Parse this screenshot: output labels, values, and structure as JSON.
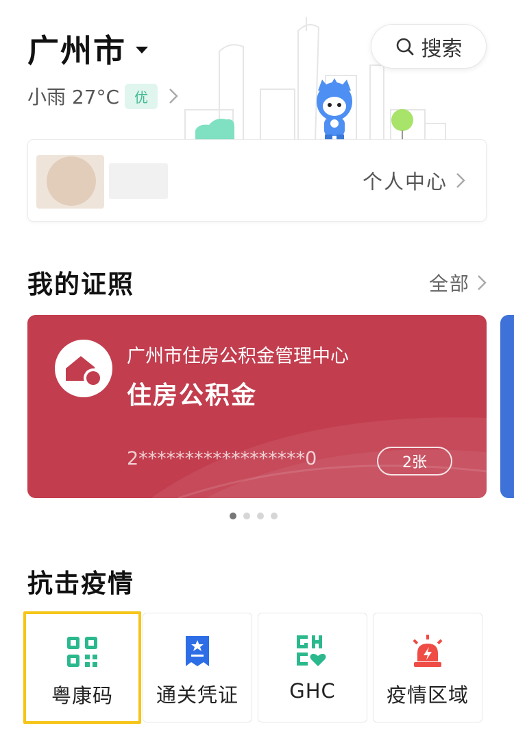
{
  "header": {
    "city": "广州市",
    "weather": "小雨 27°C",
    "air_quality": "优",
    "search_label": "搜索"
  },
  "personal": {
    "link_label": "个人中心"
  },
  "certificates": {
    "section_title": "我的证照",
    "see_all_label": "全部",
    "card": {
      "issuer": "广州市住房公积金管理中心",
      "title": "住房公积金",
      "number": "2******************0",
      "count": "2张"
    },
    "page_indicator": {
      "pages": 4,
      "active": 1
    }
  },
  "epidemic": {
    "section_title": "抗击疫情",
    "tiles": [
      {
        "label": "粤康码",
        "icon": "health-qr-icon",
        "color": "#2bb88d"
      },
      {
        "label": "通关凭证",
        "icon": "customs-ticket-icon",
        "color": "#2d6ee6"
      },
      {
        "label": "GHC",
        "icon": "ghc-icon",
        "color": "#2bb88d"
      },
      {
        "label": "疫情区域",
        "icon": "alarm-light-icon",
        "color": "#ee4c45"
      }
    ]
  },
  "colors": {
    "card_red": "#c23d4e",
    "accent_green": "#2bb88d",
    "accent_blue": "#2d6ee6",
    "alert_red": "#ee4c45",
    "highlight": "#f5c518"
  }
}
